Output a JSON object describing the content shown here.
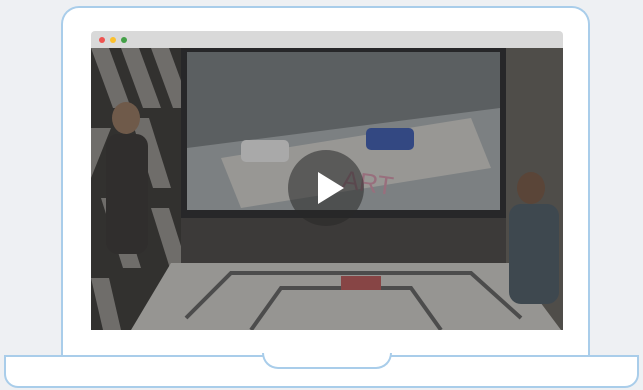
{
  "video": {
    "title": "",
    "play_label": "Play"
  },
  "colors": {
    "frame_border": "#a9cdea",
    "page_bg": "#eef0f3",
    "browser_bar": "#d9d9d9",
    "dot_red": "#ef5350",
    "dot_yellow": "#fbc02d",
    "dot_green": "#43a047"
  },
  "icons": [
    "play-icon",
    "window-close-dot",
    "window-minimize-dot",
    "window-maximize-dot"
  ]
}
